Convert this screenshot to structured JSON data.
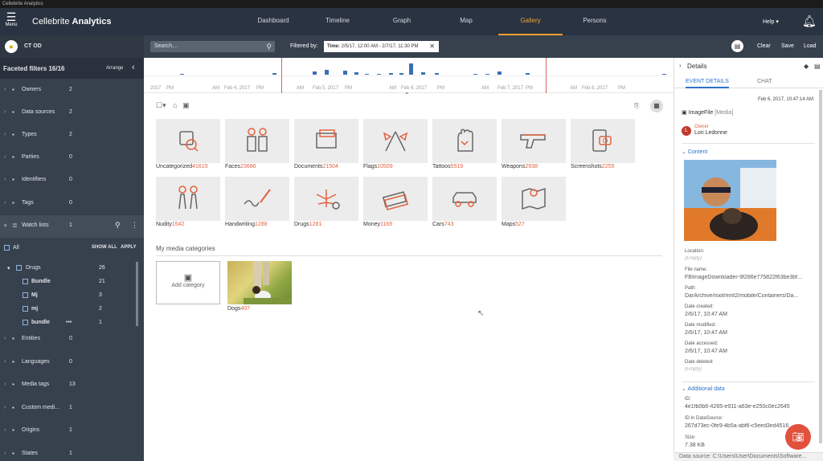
{
  "window": {
    "title": "Cellebrite Analytics"
  },
  "header": {
    "menu_label": "Menu",
    "app_name_pre": "Cellebrite",
    "app_name_post": "Analytics",
    "nav": [
      "Dashboard",
      "Timeline",
      "Graph",
      "Map",
      "Gallery",
      "Persons"
    ],
    "active_nav": "Gallery",
    "help_label": "Help ▾"
  },
  "sidebar": {
    "case_name": "CT OD",
    "faceted_title": "Faceted filters 16/16",
    "arrange_label": "Arrange",
    "facets": [
      {
        "label": "Owners",
        "count": "2"
      },
      {
        "label": "Data sources",
        "count": "2"
      },
      {
        "label": "Types",
        "count": "2"
      },
      {
        "label": "Parties",
        "count": "0"
      },
      {
        "label": "Identifiers",
        "count": "0"
      },
      {
        "label": "Tags",
        "count": "0"
      }
    ],
    "watch_lists": {
      "label": "Watch lists",
      "count": "1"
    },
    "all_label": "All",
    "show_all": "SHOW ALL",
    "apply": "APPLY",
    "tree": [
      {
        "label": "Drugs",
        "count": "26"
      },
      {
        "label": "Bundle",
        "count": "21"
      },
      {
        "label": "Mj",
        "count": "3"
      },
      {
        "label": "mj",
        "count": "2"
      },
      {
        "label": "bundle",
        "count": "1"
      }
    ],
    "facets_bottom": [
      {
        "label": "Entities",
        "count": "0"
      },
      {
        "label": "Languages",
        "count": "0"
      },
      {
        "label": "Media tags",
        "count": "13"
      },
      {
        "label": "Custom medi...",
        "count": "1"
      },
      {
        "label": "Origins",
        "count": "1"
      },
      {
        "label": "States",
        "count": "1"
      }
    ]
  },
  "toolbar": {
    "search_placeholder": "Search...",
    "filtered_by": "Filtered by:",
    "chip_key": "Time:",
    "chip_value": "2/5/17, 12:00 AM - 2/7/17, 11:30 PM",
    "clear": "Clear",
    "save": "Save",
    "load": "Load"
  },
  "timeline": {
    "labels": [
      "2017",
      "PM",
      "AM",
      "Feb 4, 2017",
      "PM",
      "AM",
      "Feb 5, 2017",
      "PM",
      "AM",
      "Feb 6, 2017",
      "PM",
      "AM",
      "Feb 7, 2017",
      "PM",
      "AM",
      "Feb 8, 2017",
      "PM"
    ],
    "bar_heights": [
      0.05,
      0.1,
      0.22,
      0.35,
      0.3,
      0.18,
      0.08,
      0.05,
      0.12,
      0.15,
      0.9,
      0.2,
      0.1,
      0.05,
      0.08,
      0.25,
      0.15,
      0.06
    ]
  },
  "gallery": {
    "categories": [
      {
        "name": "Uncategorized",
        "count": "41615",
        "icon": "uncategorized-icon"
      },
      {
        "name": "Faces",
        "count": "23686",
        "icon": "faces-icon"
      },
      {
        "name": "Documents",
        "count": "21504",
        "icon": "documents-icon"
      },
      {
        "name": "Flags",
        "count": "10509",
        "icon": "flags-icon"
      },
      {
        "name": "Tattoos",
        "count": "5519",
        "icon": "tattoos-icon"
      },
      {
        "name": "Weapons",
        "count": "2938",
        "icon": "weapons-icon"
      },
      {
        "name": "Screenshots",
        "count": "2255",
        "icon": "screenshots-icon"
      },
      {
        "name": "Nudity",
        "count": "1542",
        "icon": "nudity-icon"
      },
      {
        "name": "Handwriting",
        "count": "1288",
        "icon": "handwriting-icon"
      },
      {
        "name": "Drugs",
        "count": "1281",
        "icon": "drugs-icon"
      },
      {
        "name": "Money",
        "count": "1169",
        "icon": "money-icon"
      },
      {
        "name": "Cars",
        "count": "743",
        "icon": "cars-icon"
      },
      {
        "name": "Maps",
        "count": "527",
        "icon": "maps-icon"
      }
    ],
    "my_media_title": "My media categories",
    "add_category": "Add category",
    "custom": {
      "name": "Dogs",
      "count": "407"
    }
  },
  "details": {
    "title": "Details",
    "tabs": [
      "EVENT DETAILS",
      "CHAT"
    ],
    "date": "Feb 6, 2017, 10:47:14 AM",
    "file_type": "ImageFile",
    "file_kind": "[Media]",
    "owner_label": "Owner",
    "owner_name": "Lori Ledonne",
    "owner_initial": "L",
    "content_label": "Content",
    "fields": [
      {
        "label": "Location:",
        "value": "(Empty)",
        "empty": true
      },
      {
        "label": "File name:",
        "value": "FBImageDownloader-9f286e775822f63be3bf...",
        "empty": false
      },
      {
        "label": "Path:",
        "value": "DarArchive/root/mnt2/mobile/Containers/Da...",
        "empty": false
      },
      {
        "label": "Date created:",
        "value": "2/6/17, 10:47 AM",
        "empty": false
      },
      {
        "label": "Date modified:",
        "value": "2/6/17, 10:47 AM",
        "empty": false
      },
      {
        "label": "Date accessed:",
        "value": "2/6/17, 10:47 AM",
        "empty": false
      },
      {
        "label": "Date deleted:",
        "value": "(Empty)",
        "empty": true
      }
    ],
    "additional_label": "Additional data",
    "additional": [
      {
        "label": "ID:",
        "value": "4e1fb0b6-4265-e911-a63e-e250c0ec2645"
      },
      {
        "label": "ID in DataSource:",
        "value": "267d73ec-0fe9-4b5a-abf6-c5eed3ed4516"
      },
      {
        "label": "Size:",
        "value": "7.38 KB"
      }
    ],
    "status": "Data source: C:\\Users\\User\\Documents\\Software..."
  },
  "colors": {
    "accent": "#f0a030",
    "count": "#e2623f",
    "link": "#2e72c9",
    "sidebar": "#37404d"
  }
}
